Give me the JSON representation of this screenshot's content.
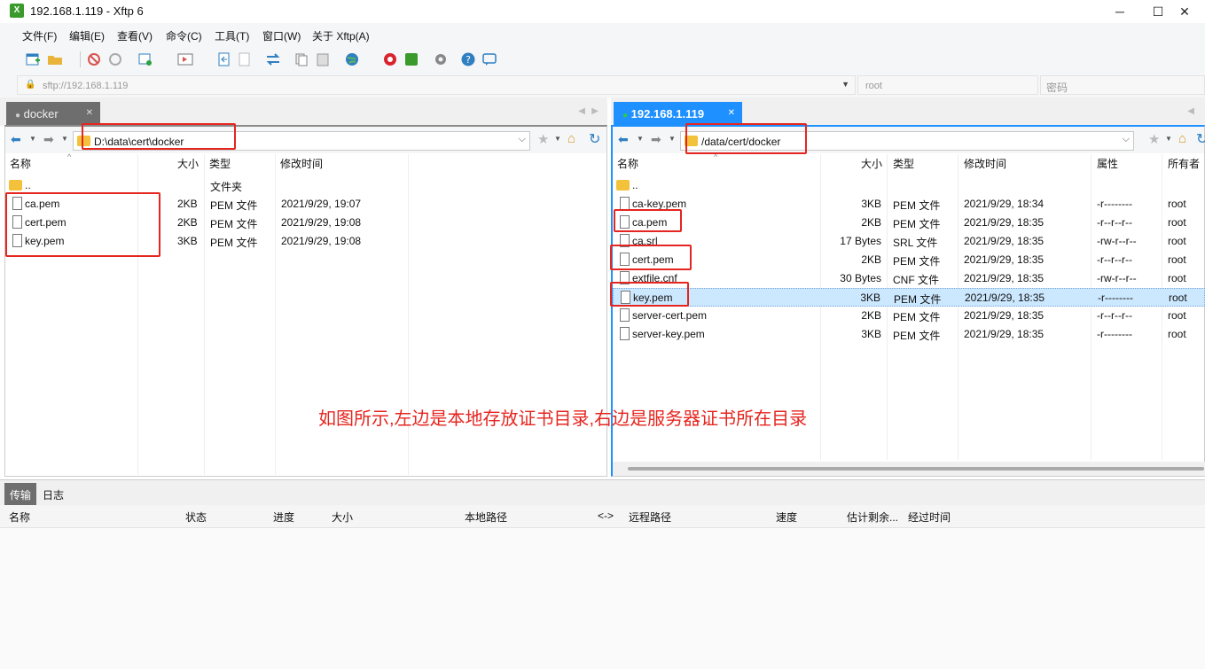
{
  "window": {
    "title": "192.168.1.119 - Xftp 6",
    "minimize": "─",
    "maximize": "☐",
    "close": "✕"
  },
  "menu": [
    "文件(F)",
    "编辑(E)",
    "查看(V)",
    "命令(C)",
    "工具(T)",
    "窗口(W)",
    "关于 Xftp(A)"
  ],
  "address": {
    "value": "sftp://192.168.1.119",
    "user": "root",
    "password_placeholder": "密码"
  },
  "left": {
    "tab": "docker",
    "path": "D:\\data\\cert\\docker",
    "columns": {
      "name": "名称",
      "size": "大小",
      "type": "类型",
      "modified": "修改时间"
    },
    "parent": {
      "name": "..",
      "type": "文件夹"
    },
    "files": [
      {
        "name": "ca.pem",
        "size": "2KB",
        "type": "PEM 文件",
        "modified": "2021/9/29, 19:07"
      },
      {
        "name": "cert.pem",
        "size": "2KB",
        "type": "PEM 文件",
        "modified": "2021/9/29, 19:08"
      },
      {
        "name": "key.pem",
        "size": "3KB",
        "type": "PEM 文件",
        "modified": "2021/9/29, 19:08"
      }
    ]
  },
  "right": {
    "tab": "192.168.1.119",
    "path": "/data/cert/docker",
    "columns": {
      "name": "名称",
      "size": "大小",
      "type": "类型",
      "modified": "修改时间",
      "attr": "属性",
      "owner": "所有者"
    },
    "parent": {
      "name": ".."
    },
    "files": [
      {
        "name": "ca-key.pem",
        "size": "3KB",
        "type": "PEM 文件",
        "modified": "2021/9/29, 18:34",
        "attr": "-r--------",
        "owner": "root"
      },
      {
        "name": "ca.pem",
        "size": "2KB",
        "type": "PEM 文件",
        "modified": "2021/9/29, 18:35",
        "attr": "-r--r--r--",
        "owner": "root"
      },
      {
        "name": "ca.srl",
        "size": "17 Bytes",
        "type": "SRL 文件",
        "modified": "2021/9/29, 18:35",
        "attr": "-rw-r--r--",
        "owner": "root"
      },
      {
        "name": "cert.pem",
        "size": "2KB",
        "type": "PEM 文件",
        "modified": "2021/9/29, 18:35",
        "attr": "-r--r--r--",
        "owner": "root"
      },
      {
        "name": "extfile.cnf",
        "size": "30 Bytes",
        "type": "CNF 文件",
        "modified": "2021/9/29, 18:35",
        "attr": "-rw-r--r--",
        "owner": "root"
      },
      {
        "name": "key.pem",
        "size": "3KB",
        "type": "PEM 文件",
        "modified": "2021/9/29, 18:35",
        "attr": "-r--------",
        "owner": "root"
      },
      {
        "name": "server-cert.pem",
        "size": "2KB",
        "type": "PEM 文件",
        "modified": "2021/9/29, 18:35",
        "attr": "-r--r--r--",
        "owner": "root"
      },
      {
        "name": "server-key.pem",
        "size": "3KB",
        "type": "PEM 文件",
        "modified": "2021/9/29, 18:35",
        "attr": "-r--------",
        "owner": "root"
      }
    ],
    "selected_index": 5
  },
  "annotation": "如图所示,左边是本地存放证书目录,右边是服务器证书所在目录",
  "transfer": {
    "tabs": [
      "传输",
      "日志"
    ],
    "columns": [
      "名称",
      "状态",
      "进度",
      "大小",
      "本地路径",
      "<->",
      "远程路径",
      "速度",
      "估计剩余...",
      "经过时间"
    ]
  },
  "colors": {
    "annotation": "#e5251f",
    "selected_row": "#cce8ff",
    "active_tab": "#1e90ff",
    "connected_dot": "#2ecc40"
  }
}
